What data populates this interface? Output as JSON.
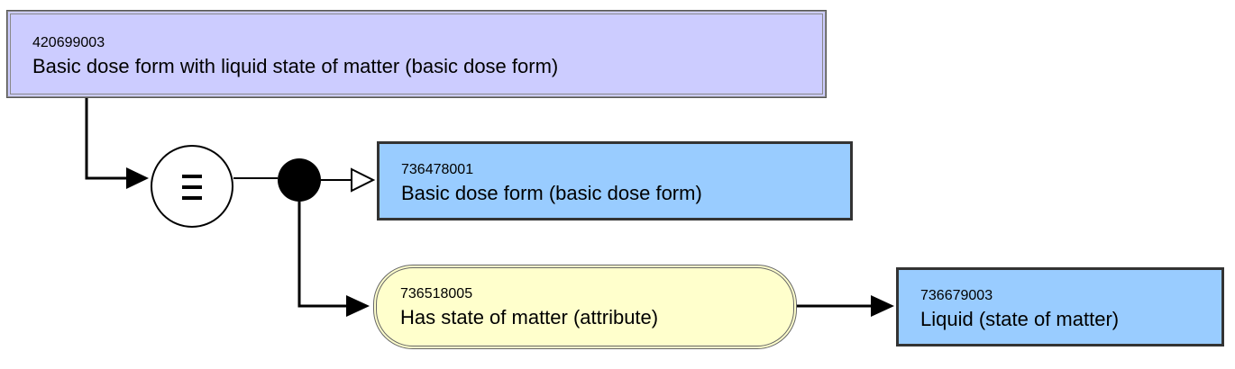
{
  "defined_concept": {
    "code": "420699003",
    "term": "Basic dose form with liquid state of matter (basic dose form)"
  },
  "definition_status": {
    "symbol": "equivalent-to-icon"
  },
  "parent_concept": {
    "code": "736478001",
    "term": "Basic dose form (basic dose form)"
  },
  "attribute": {
    "code": "736518005",
    "term": "Has state of matter (attribute)"
  },
  "attribute_value": {
    "code": "736679003",
    "term": "Liquid (state of matter)"
  },
  "colors": {
    "defined_fill": "#ccccff",
    "primitive_fill": "#99ccff",
    "attribute_fill": "#ffffcc"
  }
}
